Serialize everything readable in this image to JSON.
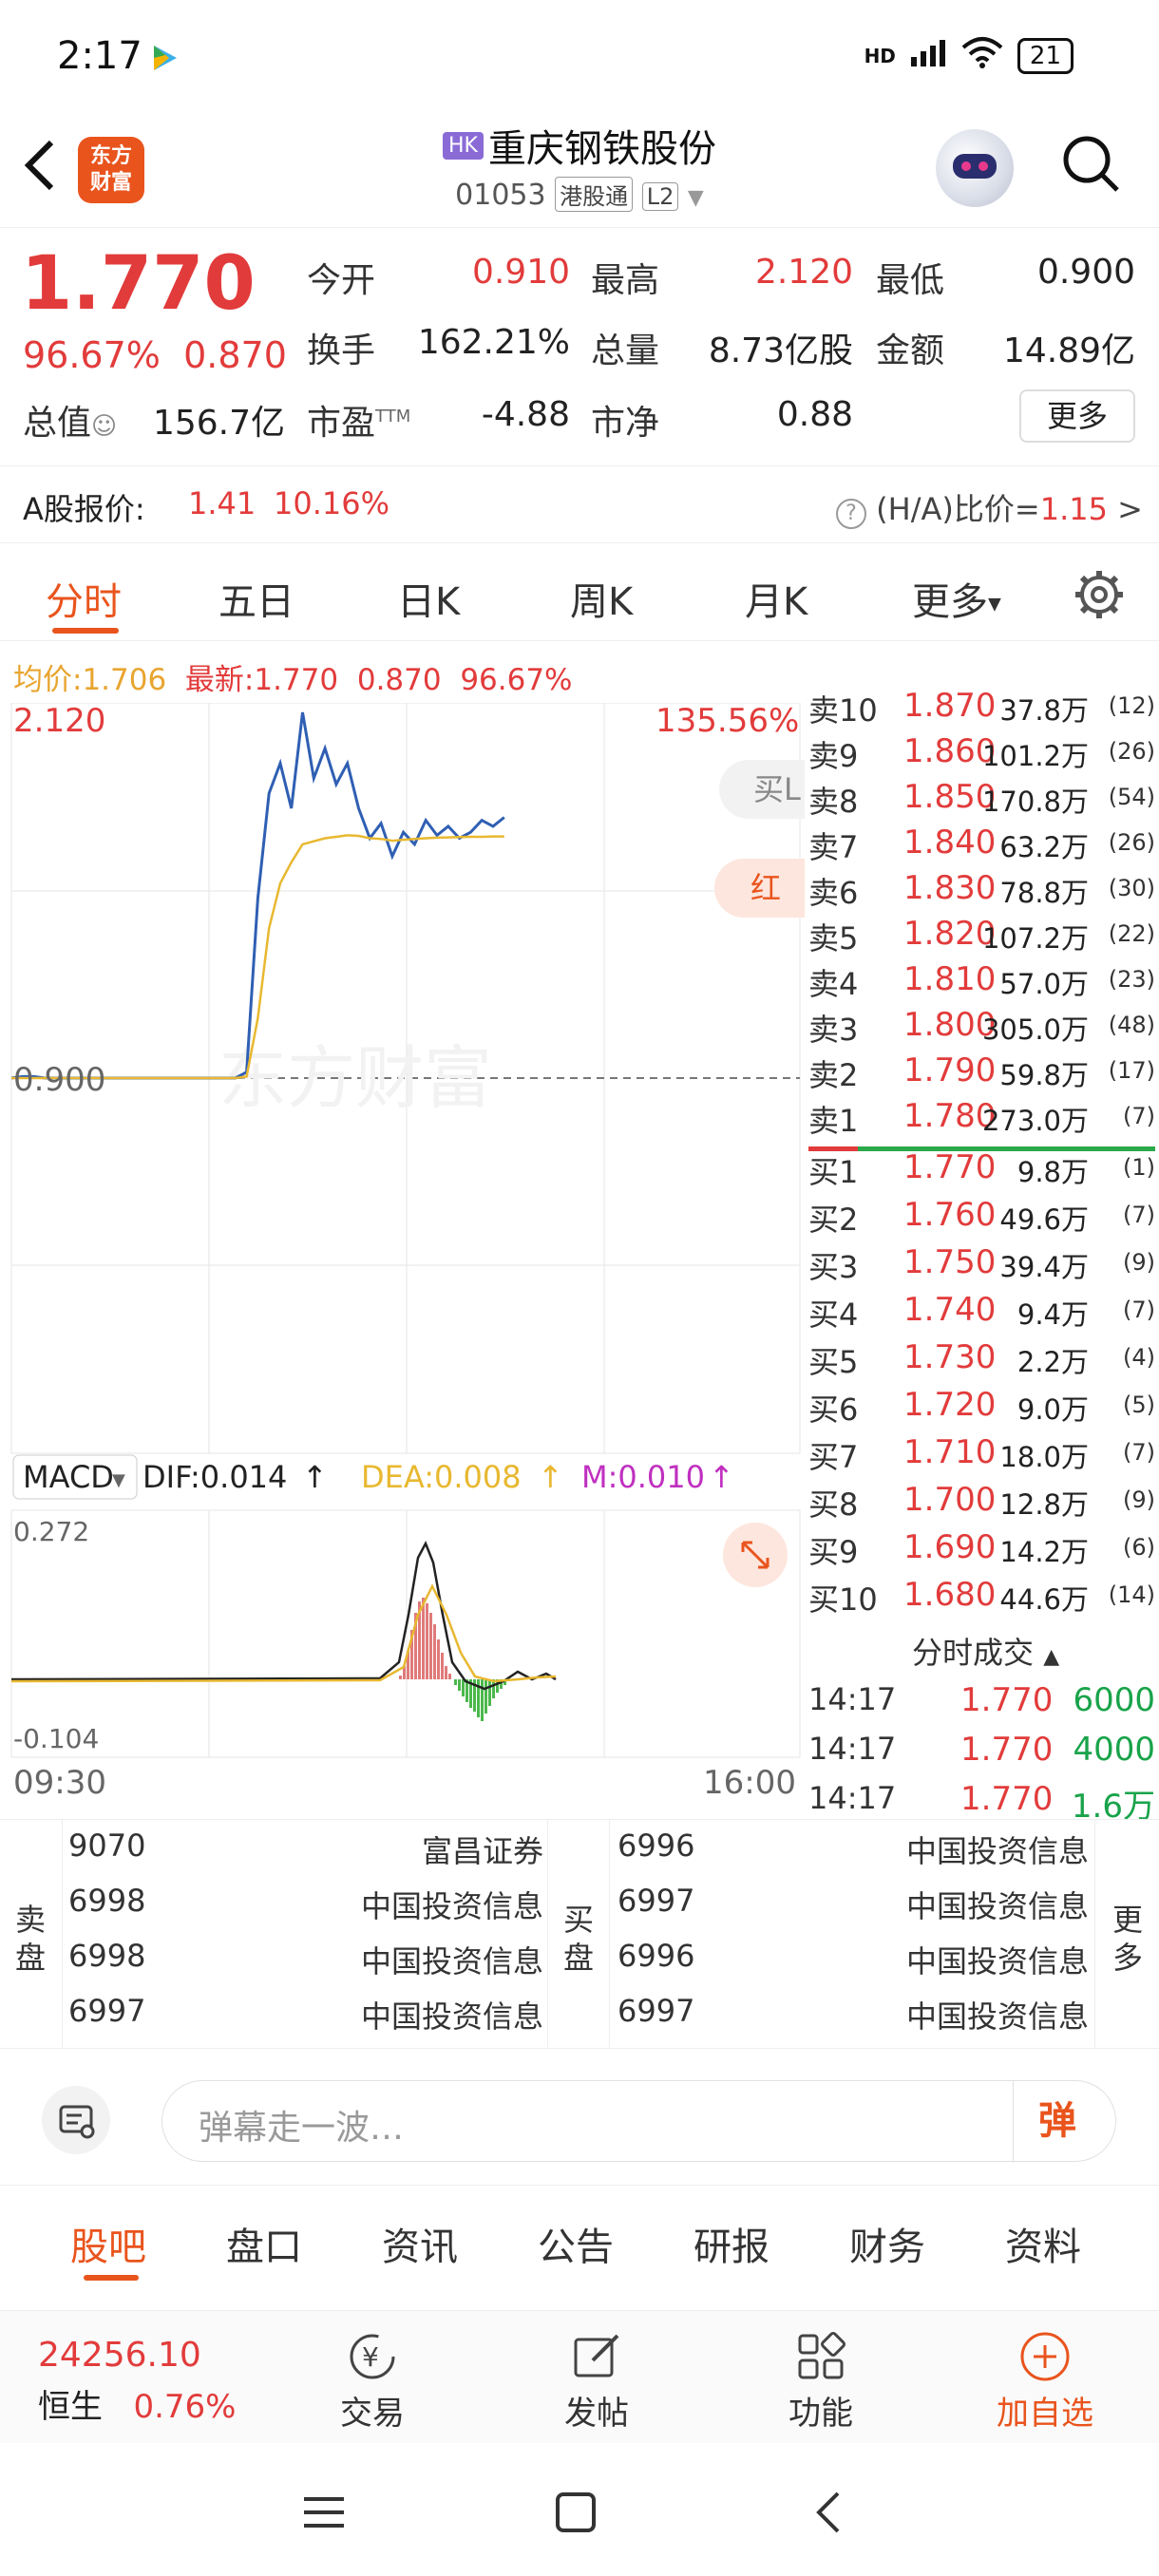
{
  "status": {
    "time": "2:17",
    "network": "HD",
    "battery": "21"
  },
  "header": {
    "logo_line1": "东方",
    "logo_line2": "财富",
    "market_tag": "HK",
    "stock_name": "重庆钢铁股份",
    "code": "01053",
    "connect_tag": "港股通",
    "level_tag": "L2"
  },
  "quote": {
    "price": "1.770",
    "change_pct": "96.67%",
    "change": "0.870",
    "open_label": "今开",
    "open": "0.910",
    "high_label": "最高",
    "high": "2.120",
    "low_label": "最低",
    "low": "0.900",
    "turnover_label": "换手",
    "turnover": "162.21%",
    "volume_label": "总量",
    "volume": "8.73亿股",
    "amount_label": "金额",
    "amount": "14.89亿",
    "mktcap_label": "总值",
    "mktcap": "156.7亿",
    "pe_label": "市盈",
    "pe_sup": "TTM",
    "pe": "-4.88",
    "pb_label": "市净",
    "pb": "0.88",
    "more": "更多"
  },
  "ashare": {
    "label": "A股报价:",
    "price": "1.41",
    "pct": "10.16%",
    "ratio_label": "(H/A)比价=",
    "ratio": "1.15"
  },
  "tabs": [
    "分时",
    "五日",
    "日K",
    "周K",
    "月K",
    "更多"
  ],
  "avgline": {
    "avg_label": "均价:",
    "avg": "1.706",
    "last_label": "最新:",
    "last": "1.770",
    "chg": "0.870",
    "pct": "96.67%"
  },
  "chart_labels": {
    "high": "2.120",
    "high_pct": "135.56%",
    "base": "0.900",
    "buy_btn": "买L",
    "red_btn": "红星",
    "watermark": "东方财富",
    "time_start": "09:30",
    "time_end": "16:00"
  },
  "chart_data": {
    "type": "line",
    "series": [
      {
        "values": [
          0.9,
          0.905,
          0.905,
          0.9,
          0.9,
          0.9,
          0.9,
          0.9,
          0.9,
          0.9,
          0.9,
          0.9,
          0.9,
          0.9,
          0.9,
          0.9,
          0.9,
          0.9,
          0.9,
          0.9,
          0.9,
          0.92,
          1.5,
          1.85,
          1.95,
          1.8,
          2.12,
          1.9,
          2.0,
          1.88,
          1.95,
          1.8,
          1.7,
          1.75,
          1.64,
          1.72,
          1.68,
          1.76,
          1.71,
          1.74,
          1.7,
          1.72,
          1.76,
          1.74,
          1.77
        ]
      },
      {
        "values": [
          0.9,
          0.9,
          0.9,
          0.9,
          0.9,
          0.9,
          0.9,
          0.9,
          0.9,
          0.9,
          0.9,
          0.9,
          0.9,
          0.9,
          0.9,
          0.9,
          0.9,
          0.9,
          0.9,
          0.9,
          0.9,
          0.905,
          1.1,
          1.4,
          1.55,
          1.62,
          1.68,
          1.69,
          1.7,
          1.705,
          1.71,
          1.708,
          1.7,
          1.698,
          1.692,
          1.695,
          1.698,
          1.7,
          1.702,
          1.703,
          1.704,
          1.705,
          1.705,
          1.706,
          1.706
        ]
      }
    ],
    "ylim": [
      0.9,
      2.12
    ],
    "x_range": [
      "09:30",
      "16:00"
    ]
  },
  "macd": {
    "name": "MACD",
    "dif": "DIF:0.014",
    "dea": "DEA:0.008",
    "m": "M:0.010",
    "top": "0.272",
    "bottom": "-0.104"
  },
  "book": {
    "asks": [
      {
        "label": "卖10",
        "price": "1.870",
        "vol": "37.8万",
        "cnt": "(12)"
      },
      {
        "label": "卖9",
        "price": "1.860",
        "vol": "101.2万",
        "cnt": "(26)"
      },
      {
        "label": "卖8",
        "price": "1.850",
        "vol": "170.8万",
        "cnt": "(54)"
      },
      {
        "label": "卖7",
        "price": "1.840",
        "vol": "63.2万",
        "cnt": "(26)"
      },
      {
        "label": "卖6",
        "price": "1.830",
        "vol": "78.8万",
        "cnt": "(30)"
      },
      {
        "label": "卖5",
        "price": "1.820",
        "vol": "107.2万",
        "cnt": "(22)"
      },
      {
        "label": "卖4",
        "price": "1.810",
        "vol": "57.0万",
        "cnt": "(23)"
      },
      {
        "label": "卖3",
        "price": "1.800",
        "vol": "305.0万",
        "cnt": "(48)"
      },
      {
        "label": "卖2",
        "price": "1.790",
        "vol": "59.8万",
        "cnt": "(17)"
      },
      {
        "label": "卖1",
        "price": "1.780",
        "vol": "273.0万",
        "cnt": "(7)"
      }
    ],
    "bids": [
      {
        "label": "买1",
        "price": "1.770",
        "vol": "9.8万",
        "cnt": "(1)"
      },
      {
        "label": "买2",
        "price": "1.760",
        "vol": "49.6万",
        "cnt": "(7)"
      },
      {
        "label": "买3",
        "price": "1.750",
        "vol": "39.4万",
        "cnt": "(9)"
      },
      {
        "label": "买4",
        "price": "1.740",
        "vol": "9.4万",
        "cnt": "(7)"
      },
      {
        "label": "买5",
        "price": "1.730",
        "vol": "2.2万",
        "cnt": "(4)"
      },
      {
        "label": "买6",
        "price": "1.720",
        "vol": "9.0万",
        "cnt": "(5)"
      },
      {
        "label": "买7",
        "price": "1.710",
        "vol": "18.0万",
        "cnt": "(7)"
      },
      {
        "label": "买8",
        "price": "1.700",
        "vol": "12.8万",
        "cnt": "(9)"
      },
      {
        "label": "买9",
        "price": "1.690",
        "vol": "14.2万",
        "cnt": "(6)"
      },
      {
        "label": "买10",
        "price": "1.680",
        "vol": "44.6万",
        "cnt": "(14)"
      }
    ],
    "trades_title": "分时成交",
    "trades": [
      {
        "time": "14:17",
        "price": "1.770",
        "vol": "6000"
      },
      {
        "time": "14:17",
        "price": "1.770",
        "vol": "4000"
      },
      {
        "time": "14:17",
        "price": "1.770",
        "vol": "1.6万"
      }
    ]
  },
  "queue": {
    "sell_label_1": "卖",
    "sell_label_2": "盘",
    "buy_label_1": "买",
    "buy_label_2": "盘",
    "more_1": "更",
    "more_2": "多",
    "sell": [
      {
        "code": "9070",
        "name": "富昌证券"
      },
      {
        "code": "6998",
        "name": "中国投资信息"
      },
      {
        "code": "6998",
        "name": "中国投资信息"
      },
      {
        "code": "6997",
        "name": "中国投资信息"
      }
    ],
    "buy": [
      {
        "code": "6996",
        "name": "中国投资信息"
      },
      {
        "code": "6997",
        "name": "中国投资信息"
      },
      {
        "code": "6996",
        "name": "中国投资信息"
      },
      {
        "code": "6997",
        "name": "中国投资信息"
      }
    ]
  },
  "comment": {
    "placeholder": "弹幕走一波…",
    "danmu": "弹"
  },
  "bottom_tabs": [
    "股吧",
    "盘口",
    "资讯",
    "公告",
    "研报",
    "财务",
    "资料"
  ],
  "bottombar": {
    "index_value": "24256.10",
    "index_name": "恒生",
    "index_pct": "0.76%",
    "trade": "交易",
    "post": "发帖",
    "func": "功能",
    "add": "加自选"
  }
}
